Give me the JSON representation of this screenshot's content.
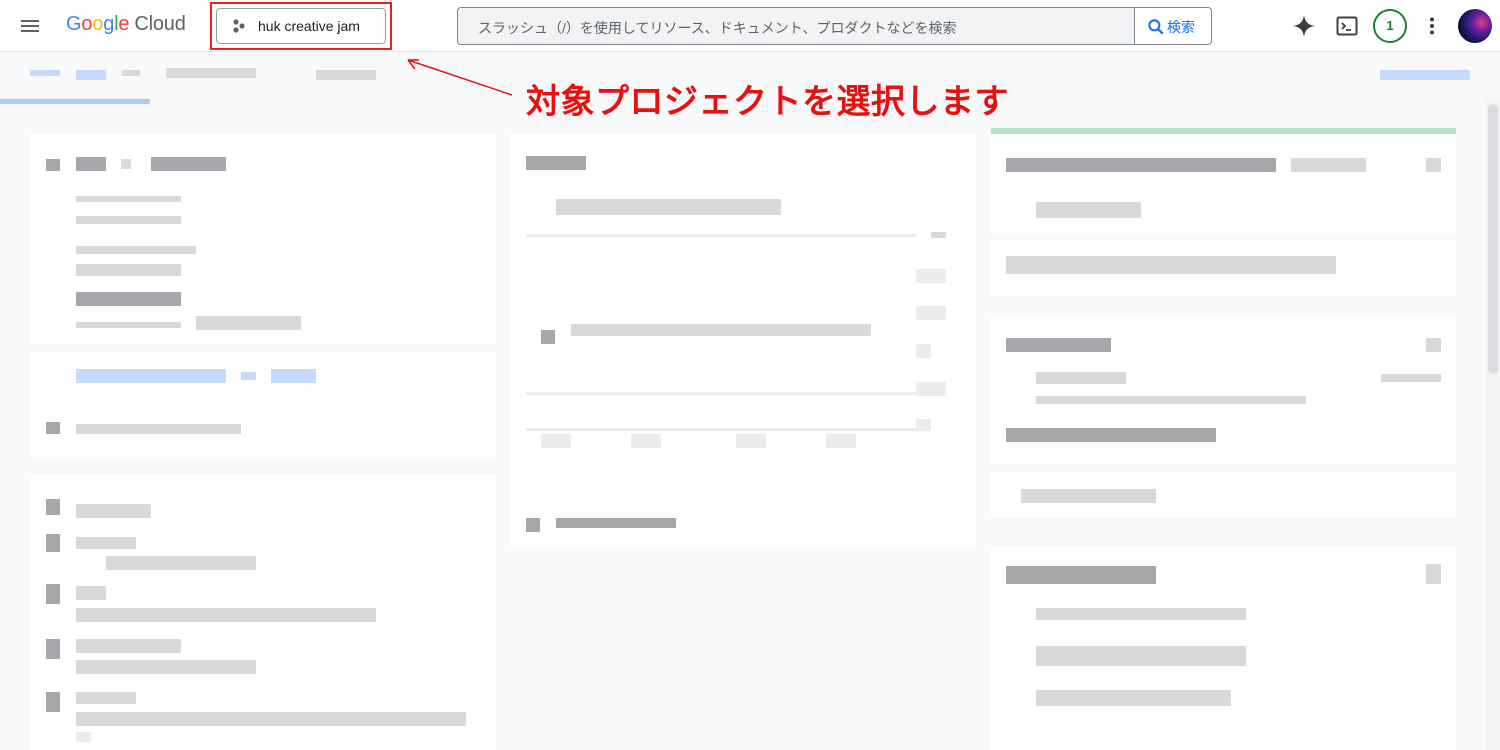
{
  "header": {
    "logo_google": "Google",
    "logo_cloud": "Cloud",
    "project_name": "huk creative jam",
    "search_placeholder": "スラッシュ（/）を使用してリソース、ドキュメント、プロダクトなどを検索",
    "search_button": "検索",
    "notification_count": "1"
  },
  "annotation": {
    "callout_text": "対象プロジェクトを選択します",
    "color": "#e8110f"
  },
  "icons": [
    "menu-icon",
    "project-dots-icon",
    "search-icon",
    "gemini-spark-icon",
    "cloud-shell-icon",
    "more-vert-icon",
    "avatar"
  ],
  "colors": {
    "highlight": "#e8211c",
    "accent_blue": "#1a73e8",
    "badge_green": "#188038"
  }
}
